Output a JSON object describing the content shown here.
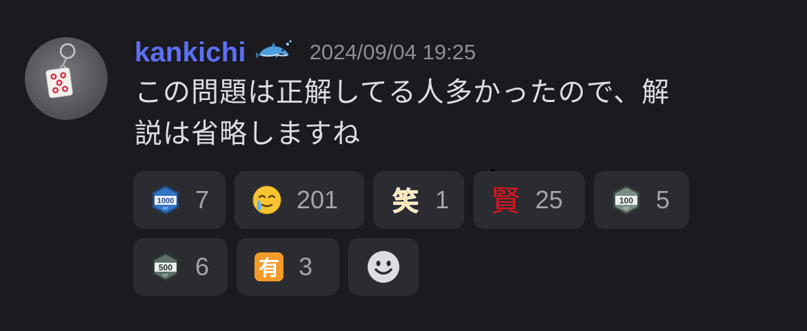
{
  "message": {
    "author": "kankichi",
    "author_badge_icon": "dolphin-icon",
    "timestamp": "2024/09/04 19:25",
    "line1": "この問題は正解してる人多かったので、解",
    "line2": "説は省略しますね"
  },
  "reactions": [
    {
      "icon": "1000-int-badge-icon",
      "count": "7"
    },
    {
      "icon": "crying-smile-emoji-icon",
      "count": "201"
    },
    {
      "icon": "warai-kanji-icon",
      "glyph": "笑",
      "count": "1"
    },
    {
      "icon": "ken-kanji-icon",
      "glyph": "賢",
      "count": "25"
    },
    {
      "icon": "100-int-badge-icon",
      "count": "5"
    },
    {
      "icon": "500-int-badge-icon",
      "count": "6"
    },
    {
      "icon": "yuu-kanji-button-icon",
      "glyph": "有",
      "count": "3"
    }
  ],
  "badges": {
    "b1000": "1000",
    "b100": "100",
    "b500": "500",
    "int": "INT"
  },
  "add_reaction_icon": "smiley-add-reaction-icon",
  "colors": {
    "background": "#1a1a1f",
    "username": "#5d70f2",
    "pill": "#2b2c31",
    "text": "#dcdde1",
    "muted": "#8e8f96"
  }
}
